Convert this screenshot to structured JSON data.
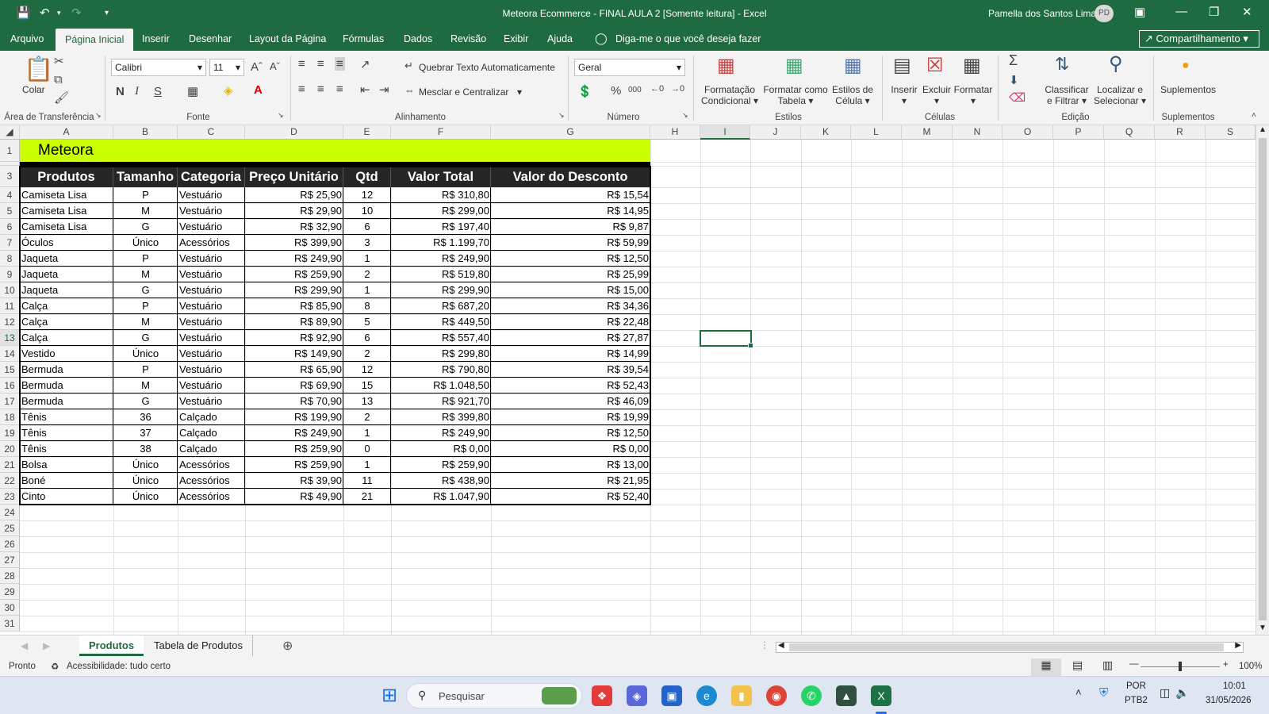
{
  "window": {
    "title": "Meteora Ecommerce - FINAL AULA 2  [Somente leitura]  -  Excel",
    "user": "Pamella dos Santos Lima",
    "initials": "PD"
  },
  "menu": {
    "tabs": [
      "Arquivo",
      "Página Inicial",
      "Inserir",
      "Desenhar",
      "Layout da Página",
      "Fórmulas",
      "Dados",
      "Revisão",
      "Exibir",
      "Ajuda"
    ],
    "tellme": "Diga-me o que você deseja fazer",
    "share": "Compartilhamento"
  },
  "ribbon": {
    "paste": "Colar",
    "clipboard": "Área de Transferência",
    "font_name": "Calibri",
    "font_size": "11",
    "font_group": "Fonte",
    "wrap": "Quebrar Texto Automaticamente",
    "merge": "Mesclar e Centralizar",
    "align_group": "Alinhamento",
    "number_format": "Geral",
    "number_group": "Número",
    "cond_fmt_1": "Formatação",
    "cond_fmt_2": "Condicional",
    "fmt_table_1": "Formatar como",
    "fmt_table_2": "Tabela",
    "cell_styles_1": "Estilos de",
    "cell_styles_2": "Célula",
    "styles_group": "Estilos",
    "insert": "Inserir",
    "delete": "Excluir",
    "format": "Formatar",
    "cells_group": "Células",
    "sort_1": "Classificar",
    "sort_2": "e Filtrar",
    "find_1": "Localizar e",
    "find_2": "Selecionar",
    "editing_group": "Edição",
    "addins": "Suplementos",
    "addins_group": "Suplementos"
  },
  "sheet": {
    "columns": [
      "A",
      "B",
      "C",
      "D",
      "E",
      "F",
      "G",
      "H",
      "I",
      "J",
      "K",
      "L",
      "M",
      "N",
      "O",
      "P",
      "Q",
      "R",
      "S"
    ],
    "selected_column": "I",
    "title": "Meteora",
    "headers": [
      "Produtos",
      "Tamanho",
      "Categoria",
      "Preço Unitário",
      "Qtd",
      "Valor Total",
      "Valor do Desconto"
    ],
    "rows": [
      [
        "Camiseta Lisa",
        "P",
        "Vestuário",
        "R$ 25,90",
        "12",
        "R$ 310,80",
        "R$ 15,54"
      ],
      [
        "Camiseta Lisa",
        "M",
        "Vestuário",
        "R$ 29,90",
        "10",
        "R$ 299,00",
        "R$ 14,95"
      ],
      [
        "Camiseta Lisa",
        "G",
        "Vestuário",
        "R$ 32,90",
        "6",
        "R$ 197,40",
        "R$ 9,87"
      ],
      [
        "Óculos",
        "Único",
        "Acessórios",
        "R$ 399,90",
        "3",
        "R$ 1.199,70",
        "R$ 59,99"
      ],
      [
        "Jaqueta",
        "P",
        "Vestuário",
        "R$ 249,90",
        "1",
        "R$ 249,90",
        "R$ 12,50"
      ],
      [
        "Jaqueta",
        "M",
        "Vestuário",
        "R$ 259,90",
        "2",
        "R$ 519,80",
        "R$ 25,99"
      ],
      [
        "Jaqueta",
        "G",
        "Vestuário",
        "R$ 299,90",
        "1",
        "R$ 299,90",
        "R$ 15,00"
      ],
      [
        "Calça",
        "P",
        "Vestuário",
        "R$ 85,90",
        "8",
        "R$ 687,20",
        "R$ 34,36"
      ],
      [
        "Calça",
        "M",
        "Vestuário",
        "R$ 89,90",
        "5",
        "R$ 449,50",
        "R$ 22,48"
      ],
      [
        "Calça",
        "G",
        "Vestuário",
        "R$ 92,90",
        "6",
        "R$ 557,40",
        "R$ 27,87"
      ],
      [
        "Vestido",
        "Único",
        "Vestuário",
        "R$ 149,90",
        "2",
        "R$ 299,80",
        "R$ 14,99"
      ],
      [
        "Bermuda",
        "P",
        "Vestuário",
        "R$ 65,90",
        "12",
        "R$ 790,80",
        "R$ 39,54"
      ],
      [
        "Bermuda",
        "M",
        "Vestuário",
        "R$ 69,90",
        "15",
        "R$ 1.048,50",
        "R$ 52,43"
      ],
      [
        "Bermuda",
        "G",
        "Vestuário",
        "R$ 70,90",
        "13",
        "R$ 921,70",
        "R$ 46,09"
      ],
      [
        "Tênis",
        "36",
        "Calçado",
        "R$ 199,90",
        "2",
        "R$ 399,80",
        "R$ 19,99"
      ],
      [
        "Tênis",
        "37",
        "Calçado",
        "R$ 249,90",
        "1",
        "R$ 249,90",
        "R$ 12,50"
      ],
      [
        "Tênis",
        "38",
        "Calçado",
        "R$ 259,90",
        "0",
        "R$ 0,00",
        "R$ 0,00"
      ],
      [
        "Bolsa",
        "Único",
        "Acessórios",
        "R$ 259,90",
        "1",
        "R$ 259,90",
        "R$ 13,00"
      ],
      [
        "Boné",
        "Único",
        "Acessórios",
        "R$ 39,90",
        "11",
        "R$ 438,90",
        "R$ 21,95"
      ],
      [
        "Cinto",
        "Único",
        "Acessórios",
        "R$ 49,90",
        "21",
        "R$ 1.047,90",
        "R$ 52,40"
      ]
    ],
    "row_numbers": [
      "1",
      "2",
      "3",
      "4",
      "5",
      "6",
      "7",
      "8",
      "9",
      "10",
      "11",
      "12",
      "13",
      "14",
      "15",
      "16",
      "17",
      "18",
      "19",
      "20",
      "21",
      "22",
      "23",
      "24",
      "25",
      "26",
      "27",
      "28",
      "29",
      "30",
      "31"
    ]
  },
  "sheets": {
    "tabs": [
      "Produtos",
      "Tabela de Produtos"
    ],
    "active": "Produtos"
  },
  "status": {
    "ready": "Pronto",
    "accessibility": "Acessibilidade: tudo certo",
    "zoom": "100%"
  },
  "taskbar": {
    "search": "Pesquisar",
    "lang": "POR",
    "layout": "PTB2",
    "time": "10:01",
    "date": "31/05/2026"
  },
  "colors": {
    "excel_green": "#1e6b41",
    "title_fill": "#ccff00",
    "header_fill": "#262626"
  }
}
